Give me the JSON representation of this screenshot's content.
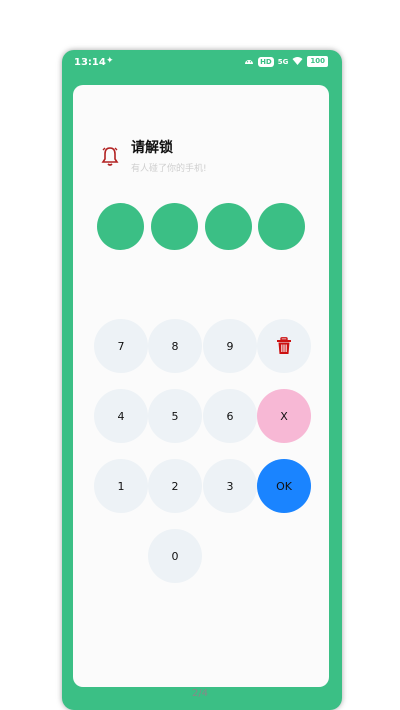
{
  "status": {
    "time": "13:14",
    "signal_small": "12.7\nKB/s",
    "hd": "HD",
    "net": "5G",
    "battery": "100"
  },
  "lock": {
    "title": "请解锁",
    "subtitle": "有人碰了你的手机!"
  },
  "pin": {
    "filled": 4,
    "total": 4
  },
  "keypad": {
    "k7": "7",
    "k8": "8",
    "k9": "9",
    "k4": "4",
    "k5": "5",
    "k6": "6",
    "clear": "X",
    "k1": "1",
    "k2": "2",
    "k3": "3",
    "ok": "OK",
    "k0": "0"
  },
  "icons": {
    "bell": "bell-alarm-icon",
    "delete": "trash-icon"
  },
  "colors": {
    "accent": "#3bbf85",
    "ok": "#1a84ff",
    "clear": "#f7b8d5",
    "delete": "#cc1111"
  },
  "pager": "2/4"
}
